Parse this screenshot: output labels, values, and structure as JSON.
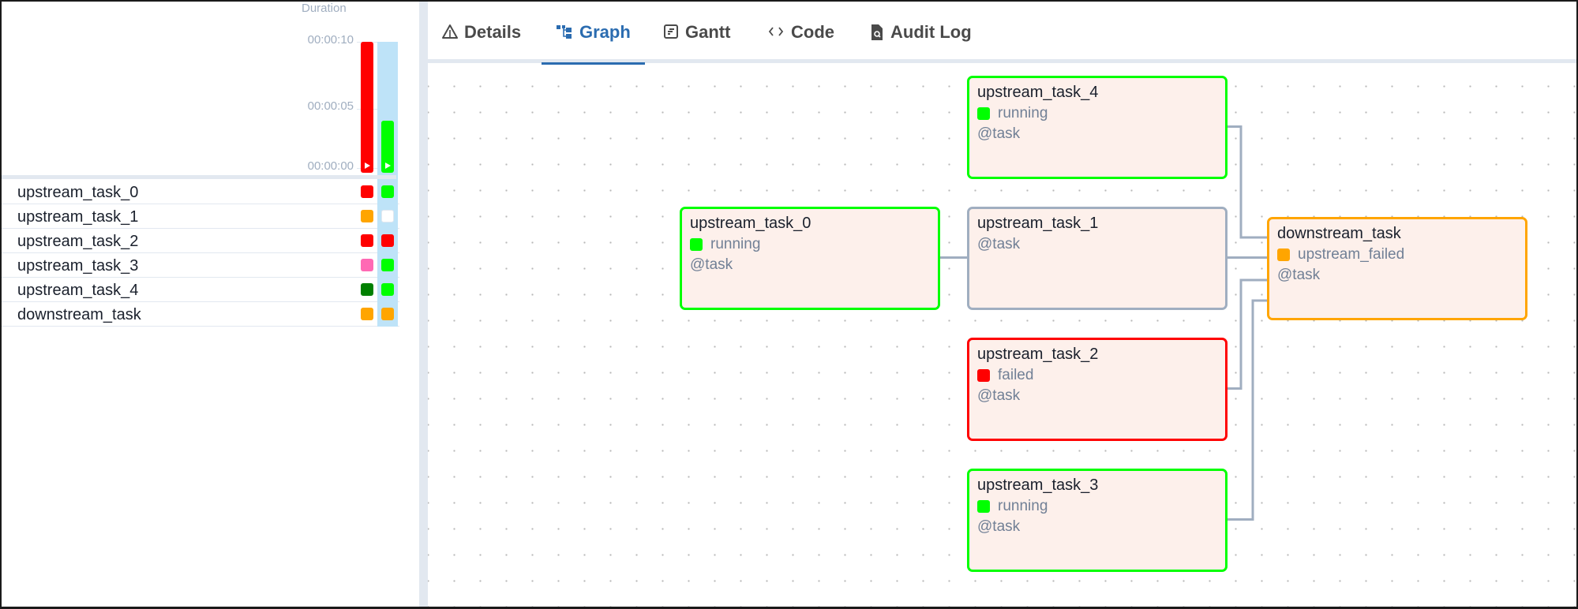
{
  "colors": {
    "running": "#00ff00",
    "failed": "#ff0000",
    "upstream_failed": "#ffa500",
    "up_for_retry": "#ff69b4",
    "success": "#008000",
    "no_status": "#ffffff",
    "edge": "#a0aec0",
    "accent": "#2b6cb0"
  },
  "grid": {
    "duration_label": "Duration",
    "ticks": [
      "00:00:10",
      "00:00:05",
      "00:00:00"
    ],
    "runs": [
      {
        "state": "failed",
        "duration_seconds": 10,
        "selected": false
      },
      {
        "state": "running",
        "duration_seconds": 4,
        "selected": true
      }
    ],
    "tasks": [
      {
        "name": "upstream_task_0",
        "states": [
          "failed",
          "running"
        ]
      },
      {
        "name": "upstream_task_1",
        "states": [
          "upstream_failed",
          "no_status"
        ]
      },
      {
        "name": "upstream_task_2",
        "states": [
          "failed",
          "failed"
        ]
      },
      {
        "name": "upstream_task_3",
        "states": [
          "up_for_retry",
          "running"
        ]
      },
      {
        "name": "upstream_task_4",
        "states": [
          "success",
          "running"
        ]
      },
      {
        "name": "downstream_task",
        "states": [
          "upstream_failed",
          "upstream_failed"
        ]
      }
    ]
  },
  "tabs": [
    {
      "label": "Details",
      "icon": "warning-triangle-icon",
      "active": false
    },
    {
      "label": "Graph",
      "icon": "graph-icon",
      "active": true
    },
    {
      "label": "Gantt",
      "icon": "gantt-icon",
      "active": false
    },
    {
      "label": "Code",
      "icon": "code-icon",
      "active": false
    },
    {
      "label": "Audit Log",
      "icon": "audit-log-icon",
      "active": false
    }
  ],
  "graph": {
    "nodes": [
      {
        "id": "upstream_task_4",
        "label": "upstream_task_4",
        "state": "running",
        "operator": "@task"
      },
      {
        "id": "upstream_task_0",
        "label": "upstream_task_0",
        "state": "running",
        "operator": "@task"
      },
      {
        "id": "upstream_task_1",
        "label": "upstream_task_1",
        "state": null,
        "operator": "@task"
      },
      {
        "id": "downstream_task",
        "label": "downstream_task",
        "state": "upstream_failed",
        "operator": "@task"
      },
      {
        "id": "upstream_task_2",
        "label": "upstream_task_2",
        "state": "failed",
        "operator": "@task"
      },
      {
        "id": "upstream_task_3",
        "label": "upstream_task_3",
        "state": "running",
        "operator": "@task"
      }
    ],
    "edges": [
      {
        "from": "upstream_task_0",
        "to": "upstream_task_1"
      },
      {
        "from": "upstream_task_4",
        "to": "downstream_task"
      },
      {
        "from": "upstream_task_1",
        "to": "downstream_task"
      },
      {
        "from": "upstream_task_2",
        "to": "downstream_task"
      },
      {
        "from": "upstream_task_3",
        "to": "downstream_task"
      }
    ]
  }
}
